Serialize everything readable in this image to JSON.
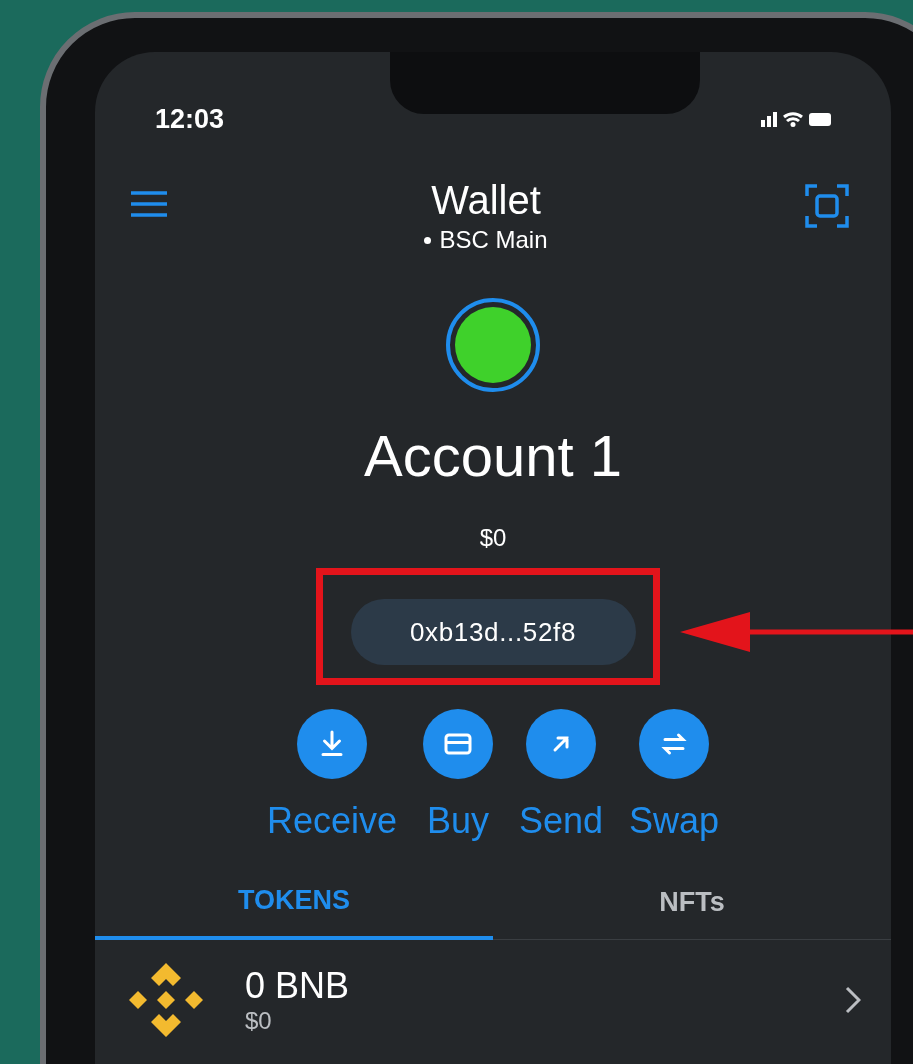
{
  "status_bar": {
    "time": "12:03"
  },
  "header": {
    "title": "Wallet",
    "network": "BSC Main"
  },
  "account": {
    "name": "Account 1",
    "balance": "$0",
    "address": "0xb13d...52f8"
  },
  "actions": [
    {
      "label": "Receive",
      "kind": "receive"
    },
    {
      "label": "Buy",
      "kind": "buy"
    },
    {
      "label": "Send",
      "kind": "send"
    },
    {
      "label": "Swap",
      "kind": "swap"
    }
  ],
  "tabs": [
    {
      "label": "TOKENS",
      "selected": true
    },
    {
      "label": "NFTs",
      "selected": false
    }
  ],
  "tokens": [
    {
      "amount": "0 BNB",
      "value": "$0"
    }
  ]
}
